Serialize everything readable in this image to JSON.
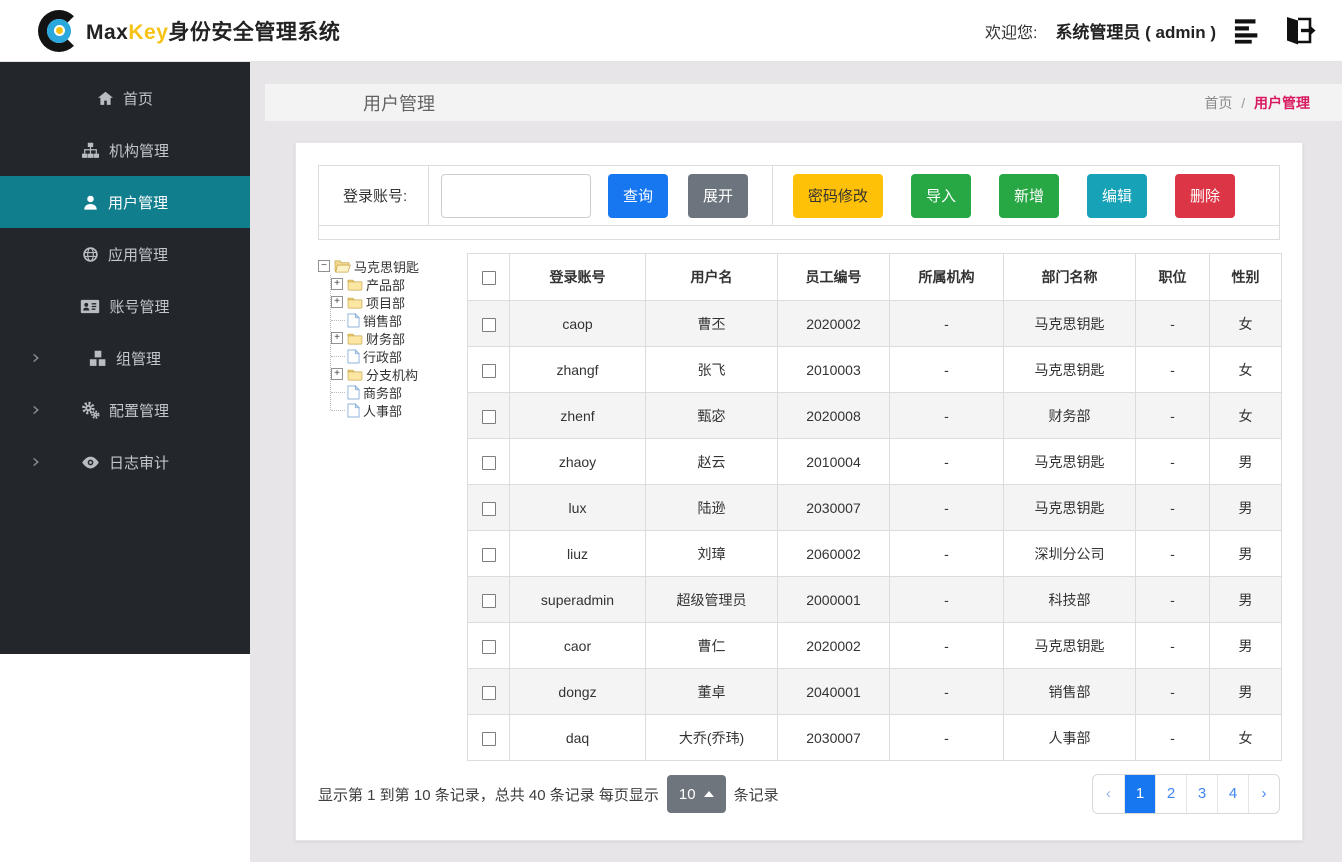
{
  "colors": {
    "sidebar_bg": "#23272b",
    "sidebar_active_bg": "#117e8e",
    "brand_key_yellow": "#f6c315",
    "breadcrumb_accent": "#d81b60",
    "primary_blue": "#1677f0",
    "secondary_gray": "#6c757d",
    "warning_yellow": "#ffc107",
    "success_green": "#28a745",
    "info_teal": "#17a2b8",
    "danger_red": "#dc3545"
  },
  "header": {
    "brand_max": "Max",
    "brand_key": "Key",
    "brand_suffix": "身份安全管理系统",
    "welcome_label": "欢迎您:",
    "user_name": "系统管理员 ( admin )"
  },
  "sidebar": {
    "items": [
      {
        "label": "首页",
        "icon": "home-icon",
        "active": false,
        "expandable": false
      },
      {
        "label": "机构管理",
        "icon": "sitemap-icon",
        "active": false,
        "expandable": false
      },
      {
        "label": "用户管理",
        "icon": "user-icon",
        "active": true,
        "expandable": false
      },
      {
        "label": "应用管理",
        "icon": "globe-icon",
        "active": false,
        "expandable": false
      },
      {
        "label": "账号管理",
        "icon": "id-card-icon",
        "active": false,
        "expandable": false
      },
      {
        "label": "组管理",
        "icon": "cubes-icon",
        "active": false,
        "expandable": true
      },
      {
        "label": "配置管理",
        "icon": "gears-icon",
        "active": false,
        "expandable": true
      },
      {
        "label": "日志审计",
        "icon": "eye-icon",
        "active": false,
        "expandable": true
      }
    ]
  },
  "page": {
    "title": "用户管理",
    "breadcrumb": {
      "home": "首页",
      "separator": "/",
      "current": "用户管理"
    }
  },
  "filter": {
    "label": "登录账号:",
    "input_value": "",
    "search_button": "查询",
    "expand_button": "展开",
    "action_buttons": [
      {
        "label": "密码修改",
        "color": "#ffc107"
      },
      {
        "label": "导入",
        "color": "#28a745"
      },
      {
        "label": "新增",
        "color": "#28a745"
      },
      {
        "label": "编辑",
        "color": "#17a2b8"
      },
      {
        "label": "删除",
        "color": "#dc3545"
      }
    ]
  },
  "tree": {
    "root": "马克思钥匙",
    "collapse_glyph": "−",
    "expand_glyph": "+",
    "nodes": [
      {
        "label": "产品部",
        "type": "branch"
      },
      {
        "label": "项目部",
        "type": "branch"
      },
      {
        "label": "销售部",
        "type": "leaf"
      },
      {
        "label": "财务部",
        "type": "branch"
      },
      {
        "label": "行政部",
        "type": "leaf"
      },
      {
        "label": "分支机构",
        "type": "branch"
      },
      {
        "label": "商务部",
        "type": "leaf"
      },
      {
        "label": "人事部",
        "type": "leaf"
      }
    ]
  },
  "table": {
    "columns": [
      "登录账号",
      "用户名",
      "员工编号",
      "所属机构",
      "部门名称",
      "职位",
      "性别"
    ],
    "rows": [
      [
        "caop",
        "曹丕",
        "2020002",
        "-",
        "马克思钥匙",
        "-",
        "女"
      ],
      [
        "zhangf",
        "张飞",
        "2010003",
        "-",
        "马克思钥匙",
        "-",
        "女"
      ],
      [
        "zhenf",
        "甄宓",
        "2020008",
        "-",
        "财务部",
        "-",
        "女"
      ],
      [
        "zhaoy",
        "赵云",
        "2010004",
        "-",
        "马克思钥匙",
        "-",
        "男"
      ],
      [
        "lux",
        "陆逊",
        "2030007",
        "-",
        "马克思钥匙",
        "-",
        "男"
      ],
      [
        "liuz",
        "刘璋",
        "2060002",
        "-",
        "深圳分公司",
        "-",
        "男"
      ],
      [
        "superadmin",
        "超级管理员",
        "2000001",
        "-",
        "科技部",
        "-",
        "男"
      ],
      [
        "caor",
        "曹仁",
        "2020002",
        "-",
        "马克思钥匙",
        "-",
        "男"
      ],
      [
        "dongz",
        "董卓",
        "2040001",
        "-",
        "销售部",
        "-",
        "男"
      ],
      [
        "daq",
        "大乔(乔玮)",
        "2030007",
        "-",
        "人事部",
        "-",
        "女"
      ]
    ]
  },
  "pagination": {
    "info_prefix": "显示第 1 到第 10 条记录，总共 40 条记录 每页显示",
    "page_size": "10",
    "info_suffix": "条记录",
    "prev": "‹",
    "next": "›",
    "pages": [
      "1",
      "2",
      "3",
      "4"
    ],
    "active_page": "1"
  }
}
